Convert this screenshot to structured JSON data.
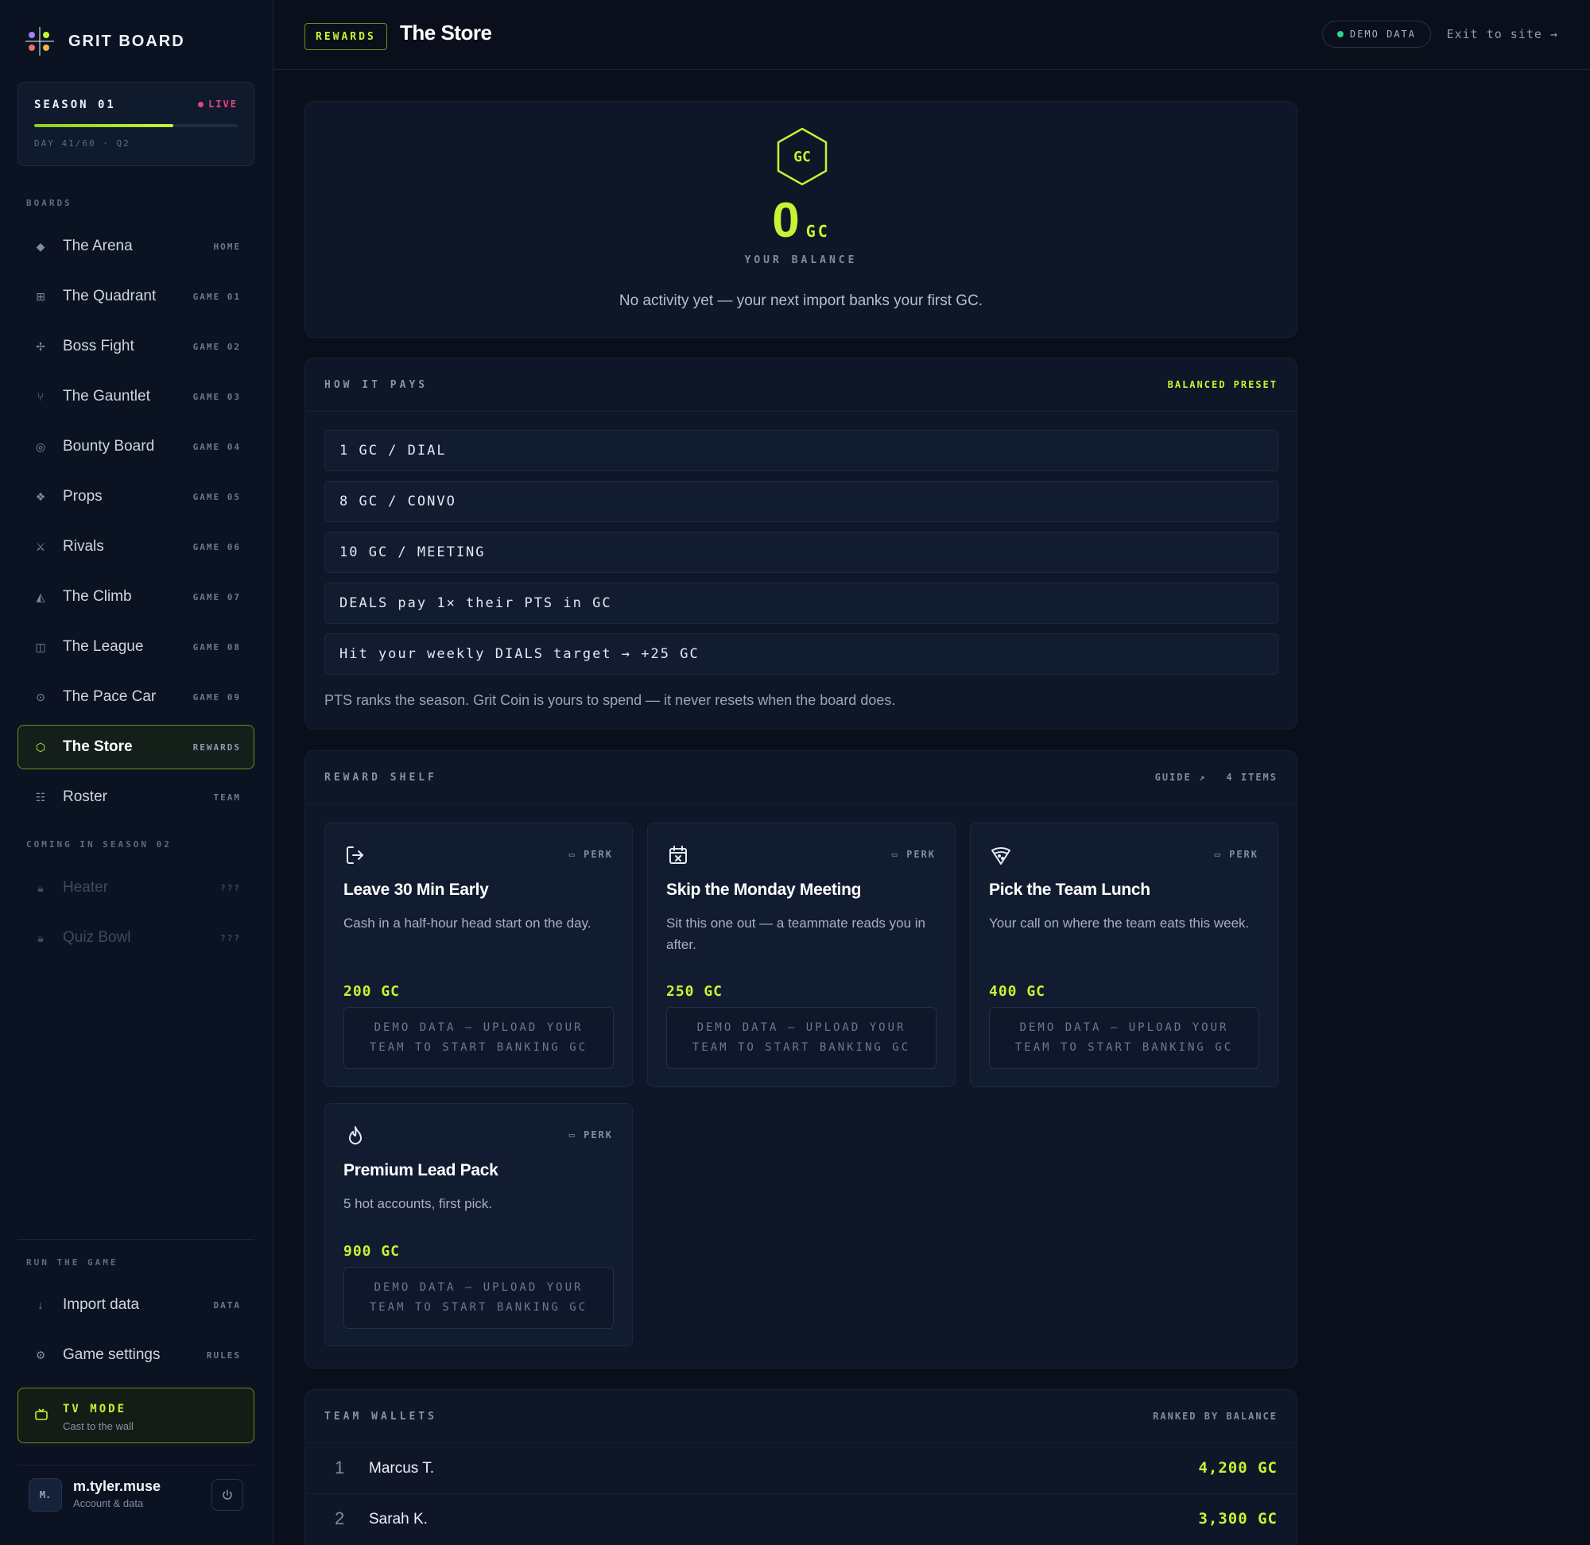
{
  "app": {
    "name": "GRIT BOARD"
  },
  "season": {
    "title": "SEASON 01",
    "status": "LIVE",
    "progress": 0.683,
    "day_text": "DAY 41/60 · Q2"
  },
  "sidebar": {
    "boards_label": "BOARDS",
    "boards": [
      {
        "label": "The Arena",
        "tag": "HOME",
        "icon": "◆",
        "icon_name": "diamond-icon"
      },
      {
        "label": "The Quadrant",
        "tag": "GAME 01",
        "icon": "⊞",
        "icon_name": "grid-icon"
      },
      {
        "label": "Boss Fight",
        "tag": "GAME 02",
        "icon": "✢",
        "icon_name": "crosshair-icon"
      },
      {
        "label": "The Gauntlet",
        "tag": "GAME 03",
        "icon": "⑂",
        "icon_name": "fork-icon"
      },
      {
        "label": "Bounty Board",
        "tag": "GAME 04",
        "icon": "◎",
        "icon_name": "target-icon"
      },
      {
        "label": "Props",
        "tag": "GAME 05",
        "icon": "❖",
        "icon_name": "props-icon"
      },
      {
        "label": "Rivals",
        "tag": "GAME 06",
        "icon": "⚔",
        "icon_name": "swords-icon"
      },
      {
        "label": "The Climb",
        "tag": "GAME 07",
        "icon": "◭",
        "icon_name": "mountain-icon"
      },
      {
        "label": "The League",
        "tag": "GAME 08",
        "icon": "◫",
        "icon_name": "league-icon"
      },
      {
        "label": "The Pace Car",
        "tag": "GAME 09",
        "icon": "⊙",
        "icon_name": "gauge-icon"
      },
      {
        "label": "The Store",
        "tag": "REWARDS",
        "icon": "⬡",
        "icon_name": "hexagon-icon"
      },
      {
        "label": "Roster",
        "tag": "TEAM",
        "icon": "☷",
        "icon_name": "list-icon"
      }
    ],
    "coming_label": "COMING IN SEASON 02",
    "coming": [
      {
        "label": "Heater",
        "tag": "???",
        "icon": "🔒︎",
        "icon_name": "lock-icon"
      },
      {
        "label": "Quiz Bowl",
        "tag": "???",
        "icon": "🔒︎",
        "icon_name": "lock-icon"
      }
    ],
    "run_label": "RUN THE GAME",
    "run": [
      {
        "label": "Import data",
        "tag": "DATA",
        "icon": "↓",
        "icon_name": "download-icon"
      },
      {
        "label": "Game settings",
        "tag": "RULES",
        "icon": "⚙",
        "icon_name": "gear-icon"
      }
    ],
    "tv": {
      "title": "TV MODE",
      "subtitle": "Cast to the wall"
    },
    "user": {
      "initials": "M.",
      "name": "m.tyler.muse",
      "subtitle": "Account & data"
    }
  },
  "topbar": {
    "badge": "REWARDS",
    "title": "The Store",
    "demo_pill": "DEMO DATA",
    "exit_link": "Exit to site →"
  },
  "balance": {
    "coin_label": "GC",
    "amount": "0",
    "unit": "GC",
    "label": "YOUR BALANCE",
    "note": "No activity yet — your next import banks your first GC."
  },
  "how_it_pays": {
    "title": "HOW IT PAYS",
    "preset": "BALANCED PRESET",
    "rules": [
      "1 GC / DIAL",
      "8 GC / CONVO",
      "10 GC / MEETING",
      "DEALS pay 1× their PTS in GC",
      "Hit your weekly DIALS target → +25 GC"
    ],
    "note": "PTS ranks the season. Grit Coin is yours to spend — it never resets when the board does."
  },
  "reward_shelf": {
    "title": "REWARD SHELF",
    "guide": "GUIDE ↗",
    "count": "4 ITEMS",
    "items": [
      {
        "icon": "exit-icon",
        "perk": "PERK",
        "title": "Leave 30 Min Early",
        "desc": "Cash in a half-hour head start on the day.",
        "price": "200 GC",
        "button": "DEMO DATA — UPLOAD YOUR TEAM TO START BANKING GC"
      },
      {
        "icon": "calendar-x-icon",
        "perk": "PERK",
        "title": "Skip the Monday Meeting",
        "desc": "Sit this one out — a teammate reads you in after.",
        "price": "250 GC",
        "button": "DEMO DATA — UPLOAD YOUR TEAM TO START BANKING GC"
      },
      {
        "icon": "pizza-icon",
        "perk": "PERK",
        "title": "Pick the Team Lunch",
        "desc": "Your call on where the team eats this week.",
        "price": "400 GC",
        "button": "DEMO DATA — UPLOAD YOUR TEAM TO START BANKING GC"
      },
      {
        "icon": "flame-icon",
        "perk": "PERK",
        "title": "Premium Lead Pack",
        "desc": "5 hot accounts, first pick.",
        "price": "900 GC",
        "button": "DEMO DATA — UPLOAD YOUR TEAM TO START BANKING GC"
      }
    ]
  },
  "team_wallets": {
    "title": "TEAM WALLETS",
    "sort": "RANKED BY BALANCE",
    "rows": [
      {
        "rank": "1",
        "name": "Marcus T.",
        "balance": "4,200 GC"
      },
      {
        "rank": "2",
        "name": "Sarah K.",
        "balance": "3,300 GC"
      }
    ]
  },
  "colors": {
    "accent": "#c6f432",
    "live": "#e2457a",
    "demo_dot": "#2ed58b",
    "background": "#0a0f1b",
    "panel": "#0e1628"
  }
}
